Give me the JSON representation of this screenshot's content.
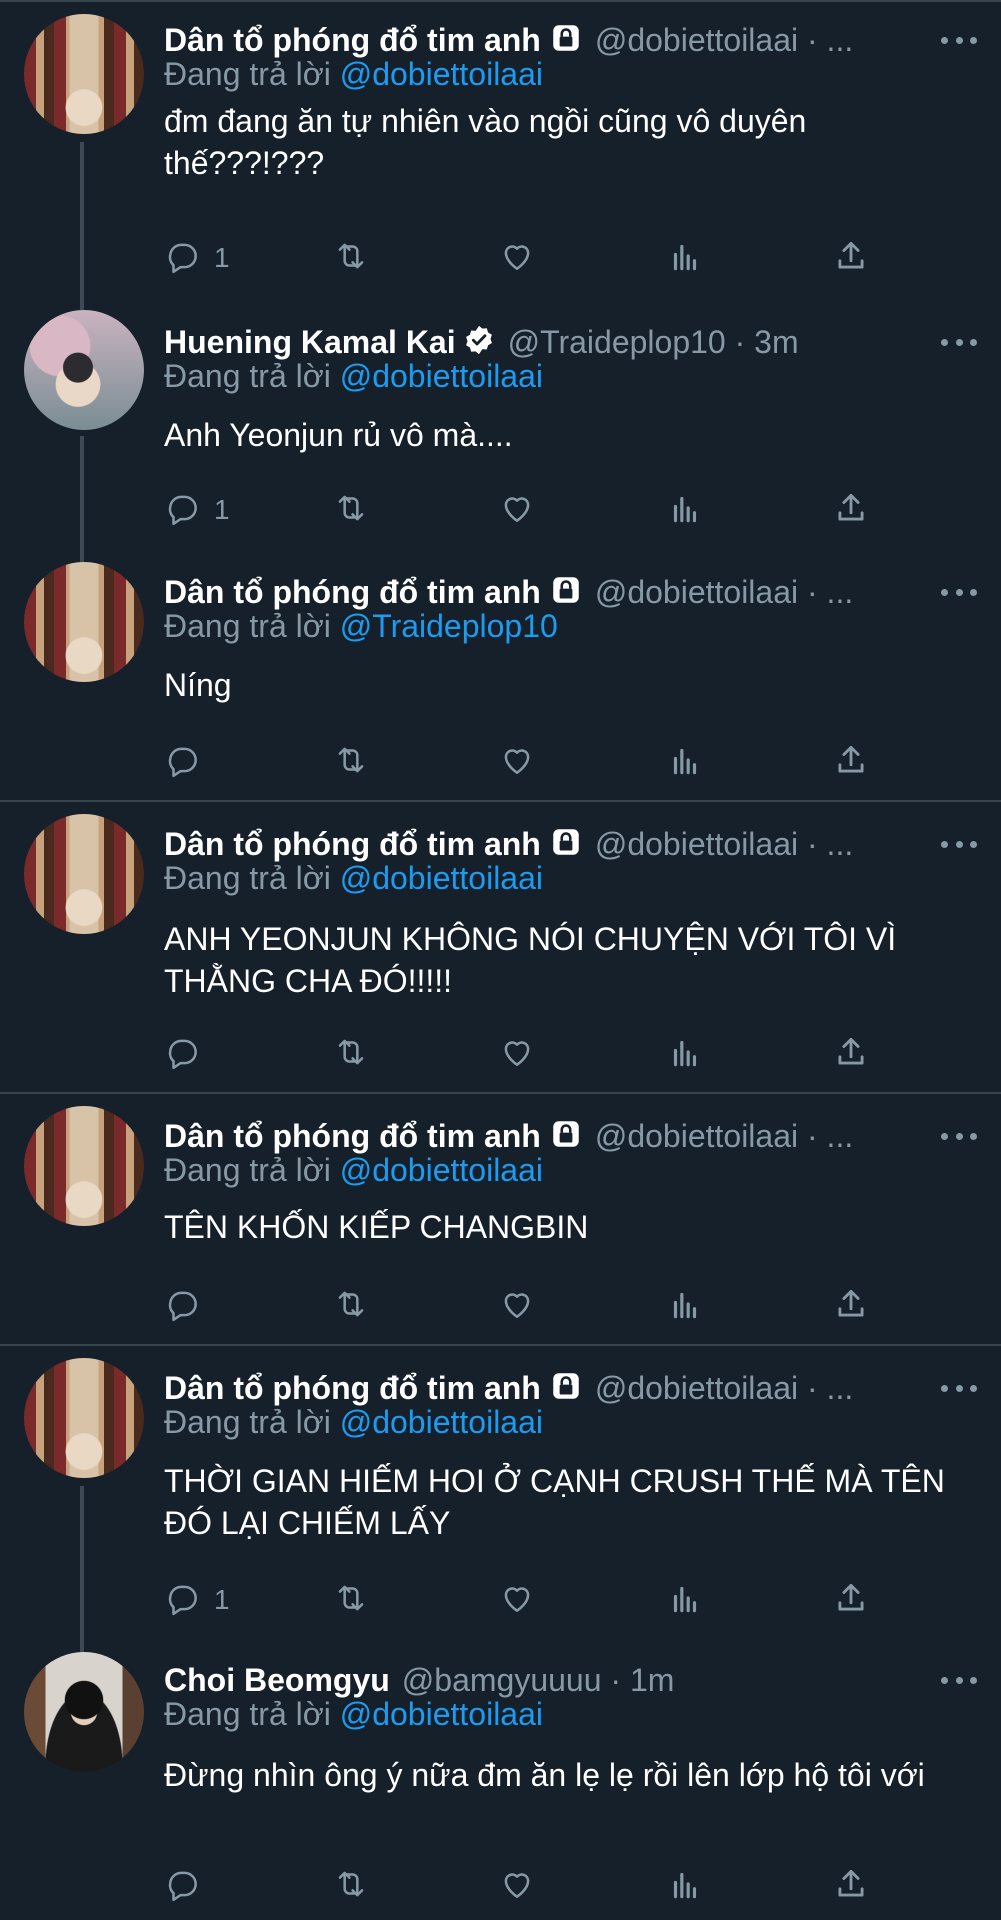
{
  "tweets": [
    {
      "display_name": "Dân tổ phóng đổ tim anh",
      "handle": "@dobiettoilaai · ...",
      "locked": true,
      "verified": false,
      "avatar": "doll",
      "reply_prefix": "Đang trả lời",
      "reply_to": "@dobiettoilaai",
      "text": "đm đang ăn tự nhiên vào ngồi cũng vô duyên thế???!???",
      "reply_count": "1"
    },
    {
      "display_name": "Huening Kamal Kai",
      "handle": "@Traideplop10 · 3m",
      "locked": false,
      "verified": true,
      "avatar": "kai",
      "reply_prefix": "Đang trả lời",
      "reply_to": "@dobiettoilaai",
      "text": "Anh Yeonjun rủ vô mà....",
      "reply_count": "1"
    },
    {
      "display_name": "Dân tổ phóng đổ tim anh",
      "handle": "@dobiettoilaai · ...",
      "locked": true,
      "verified": false,
      "avatar": "doll",
      "reply_prefix": "Đang trả lời",
      "reply_to": "@Traideplop10",
      "text": "Níng",
      "reply_count": ""
    },
    {
      "display_name": "Dân tổ phóng đổ tim anh",
      "handle": "@dobiettoilaai · ...",
      "locked": true,
      "verified": false,
      "avatar": "doll",
      "reply_prefix": "Đang trả lời",
      "reply_to": "@dobiettoilaai",
      "text": "ANH YEONJUN KHÔNG NÓI CHUYỆN VỚI TÔI VÌ THẰNG CHA ĐÓ!!!!!",
      "reply_count": ""
    },
    {
      "display_name": "Dân tổ phóng đổ tim anh",
      "handle": "@dobiettoilaai · ...",
      "locked": true,
      "verified": false,
      "avatar": "doll",
      "reply_prefix": "Đang trả lời",
      "reply_to": "@dobiettoilaai",
      "text": "TÊN KHỐN KIẾP CHANGBIN",
      "reply_count": ""
    },
    {
      "display_name": "Dân tổ phóng đổ tim anh",
      "handle": "@dobiettoilaai · ...",
      "locked": true,
      "verified": false,
      "avatar": "doll",
      "reply_prefix": "Đang trả lời",
      "reply_to": "@dobiettoilaai",
      "text": "THỜI GIAN HIẾM HOI Ở CẠNH CRUSH THẾ MÀ TÊN ĐÓ LẠI CHIẾM LẤY",
      "reply_count": "1"
    },
    {
      "display_name": "Choi Beomgyu",
      "handle": "@bamgyuuuu · 1m",
      "locked": false,
      "verified": false,
      "avatar": "beomgyu",
      "reply_prefix": "Đang trả lời",
      "reply_to": "@dobiettoilaai",
      "text": "Đừng nhìn ông ý nữa đm ăn lẹ lẹ rồi lên lớp hộ tôi với",
      "reply_count": ""
    }
  ],
  "icons": {
    "reply": "reply-icon",
    "retweet": "retweet-icon",
    "like": "like-icon",
    "views": "views-icon",
    "share": "share-icon",
    "more": "more-icon",
    "lock": "lock-icon",
    "verified": "verified-icon"
  },
  "colors": {
    "background": "#15202b",
    "text": "#ffffff",
    "secondary": "#8899a6",
    "mention": "#1d9bf0",
    "separator": "#38444d"
  }
}
